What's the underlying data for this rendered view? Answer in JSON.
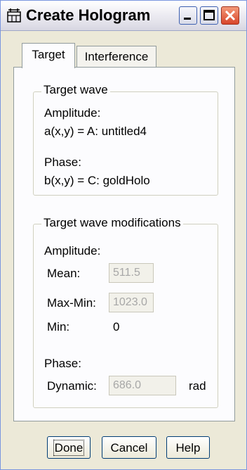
{
  "window": {
    "title": "Create Hologram",
    "title_icon": "hologram-app-icon",
    "controls": {
      "minimize": "minimize-icon",
      "maximize": "maximize-icon",
      "close": "close-icon"
    },
    "accent": "#3d5fb0",
    "close_color": "#d8452a"
  },
  "tabs": [
    {
      "label": "Target",
      "selected": true
    },
    {
      "label": "Interference",
      "selected": false
    }
  ],
  "target_wave": {
    "title": "Target wave",
    "amplitude_label": "Amplitude:",
    "amplitude_value": "a(x,y)  =  A: untitled4",
    "phase_label": "Phase:",
    "phase_value": "b(x,y)  =  C: goldHolo"
  },
  "modifications": {
    "title": "Target wave modifications",
    "amplitude_label": "Amplitude:",
    "mean_label": "Mean:",
    "mean_value": "511.5",
    "maxmin_label": "Max-Min:",
    "maxmin_value": "1023.0",
    "min_label": "Min:",
    "min_value": "0",
    "phase_label": "Phase:",
    "dynamic_label": "Dynamic:",
    "dynamic_value": "686.0",
    "dynamic_unit": "rad"
  },
  "buttons": {
    "done": "Done",
    "cancel": "Cancel",
    "help": "Help"
  }
}
